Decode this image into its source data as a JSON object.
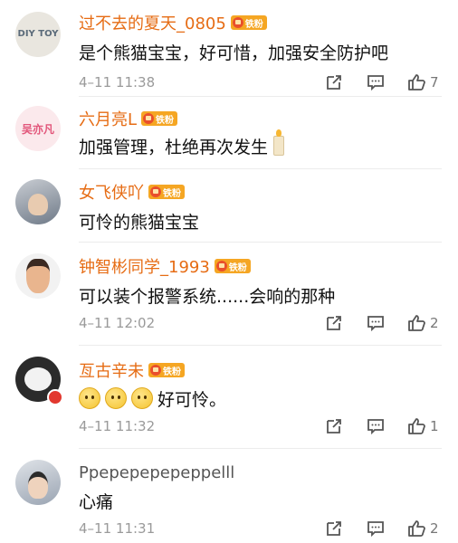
{
  "comments": [
    {
      "user": "过不去的夏天_0805",
      "badge": "铁粉",
      "avatar_text": "DIY TOY",
      "text": "是个熊猫宝宝，好可惜，加强安全防护吧",
      "time": "4–11 11:38",
      "likes": "7"
    },
    {
      "user": "六月亮L",
      "badge": "铁粉",
      "avatar_text": "吴亦凡",
      "text": "加强管理，杜绝再次发生",
      "emoji": "candle"
    },
    {
      "user": "女飞侠吖",
      "badge": "铁粉",
      "text": "可怜的熊猫宝宝"
    },
    {
      "user": "钟智彬同学_1993",
      "badge": "铁粉",
      "text": "可以装个报警系统......会响的那种",
      "time": "4–11 12:02",
      "likes": "2"
    },
    {
      "user": "亙古辛未",
      "badge": "铁粉",
      "text": "好可怜。",
      "time": "4–11 11:32",
      "likes": "1"
    },
    {
      "user": "Ppepepepepeppelll",
      "text": "心痛",
      "time": "4–11 11:31",
      "likes": "2"
    }
  ],
  "colors": {
    "username": "#e66c14",
    "badge": "#f5a623",
    "meta": "#9a9a9a"
  },
  "icons": [
    "share-icon",
    "comment-icon",
    "like-icon"
  ]
}
